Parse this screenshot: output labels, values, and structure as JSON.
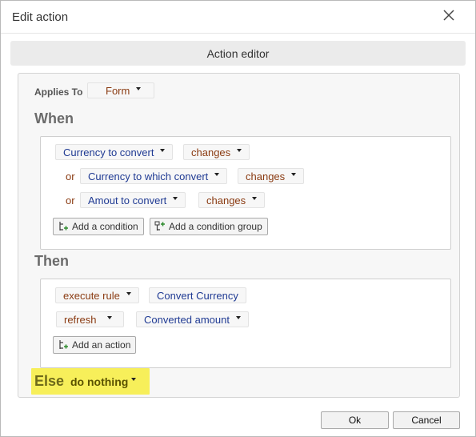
{
  "dialog": {
    "title": "Edit action",
    "header": "Action editor"
  },
  "applies_to": {
    "label": "Applies To",
    "value": "Form"
  },
  "when": {
    "heading": "When",
    "conditions": [
      {
        "connector": "",
        "field": "Currency to convert",
        "operator": "changes"
      },
      {
        "connector": "or",
        "field": "Currency to which convert",
        "operator": "changes"
      },
      {
        "connector": "or",
        "field": "Amout to convert",
        "operator": "changes"
      }
    ],
    "add_condition_label": "Add a condition",
    "add_condition_group_label": "Add a condition group"
  },
  "then": {
    "heading": "Then",
    "actions": [
      {
        "verb": "execute rule",
        "target": "Convert Currency"
      },
      {
        "verb": "refresh",
        "target": "Converted amount"
      }
    ],
    "add_action_label": "Add an action"
  },
  "else": {
    "heading": "Else",
    "value": "do nothing",
    "highlight_color": "#f7ef5a"
  },
  "footer": {
    "ok_label": "Ok",
    "cancel_label": "Cancel"
  },
  "icons": {
    "close": "close-icon",
    "add_condition": "add-condition-icon",
    "add_condition_group": "add-condition-group-icon",
    "add_action": "add-action-icon"
  },
  "colors": {
    "field_text": "#1f3a93",
    "operator_text": "#8a3b12",
    "header_bg": "#ebebeb"
  }
}
